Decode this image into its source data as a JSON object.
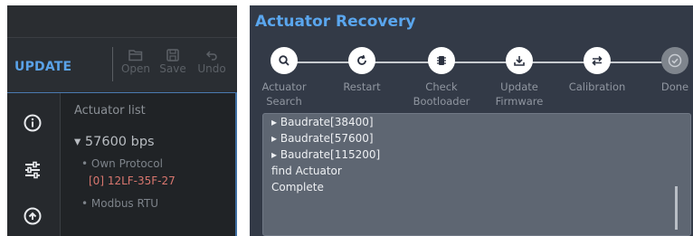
{
  "left_panel": {
    "toolbar": {
      "section_title": "UPDATE",
      "open_label": "Open",
      "save_label": "Save",
      "undo_label": "Undo"
    },
    "sidebar_icons": [
      "info-icon",
      "sliders-icon",
      "upload-icon"
    ],
    "tree": {
      "header": "Actuator list",
      "baud_rate": "57600 bps",
      "protocol": "• Own Protocol",
      "actuator": "[0] 12LF-35F-27",
      "other_protocol": "• Modbus RTU"
    }
  },
  "recovery": {
    "title": "Actuator Recovery",
    "steps": [
      {
        "line1": "Actuator",
        "line2": "Search",
        "icon": "search-icon"
      },
      {
        "line1": "Restart",
        "line2": "",
        "icon": "restart-icon"
      },
      {
        "line1": "Check",
        "line2": "Bootloader",
        "icon": "chip-icon"
      },
      {
        "line1": "Update",
        "line2": "Firmware",
        "icon": "download-icon"
      },
      {
        "line1": "Calibration",
        "line2": "",
        "icon": "swap-arrows-icon"
      },
      {
        "line1": "Done",
        "line2": "",
        "icon": "check-icon"
      }
    ],
    "log": [
      "▸ Baudrate[38400]",
      "▸ Baudrate[57600]",
      "▸ Baudrate[115200]",
      "find Actuator",
      "Complete"
    ]
  },
  "colors": {
    "accent": "#5aa6ee",
    "actuator_id": "#d9776f",
    "left_bg": "#202326",
    "right_bg": "#333a47"
  }
}
